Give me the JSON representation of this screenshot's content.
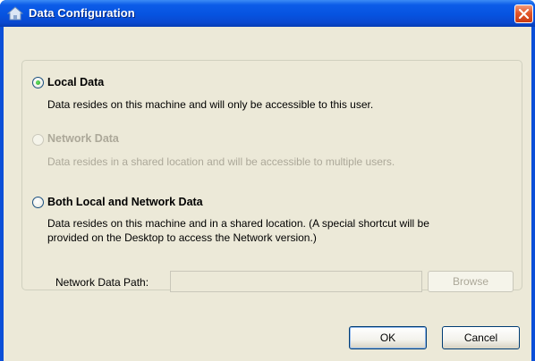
{
  "window": {
    "title": "Data Configuration",
    "icon": "home-icon",
    "close_icon": "close-icon",
    "titlebar_color": "#0653e0",
    "close_color": "#e2562a"
  },
  "options": [
    {
      "label": "Local Data",
      "description": "Data resides on this machine and will only be accessible to this user.",
      "selected": true,
      "enabled": true
    },
    {
      "label": "Network Data",
      "description": "Data resides in a shared location and will be accessible to multiple users.",
      "selected": false,
      "enabled": false
    },
    {
      "label": "Both Local and Network Data",
      "description_line1": "Data resides on this machine and in a shared location.  (A special shortcut will be",
      "description_line2": "provided on the Desktop to access the Network version.)",
      "selected": false,
      "enabled": true
    }
  ],
  "network_path": {
    "label": "Network Data Path:",
    "value": "",
    "browse_label": "Browse"
  },
  "buttons": {
    "ok_label": "OK",
    "cancel_label": "Cancel"
  }
}
